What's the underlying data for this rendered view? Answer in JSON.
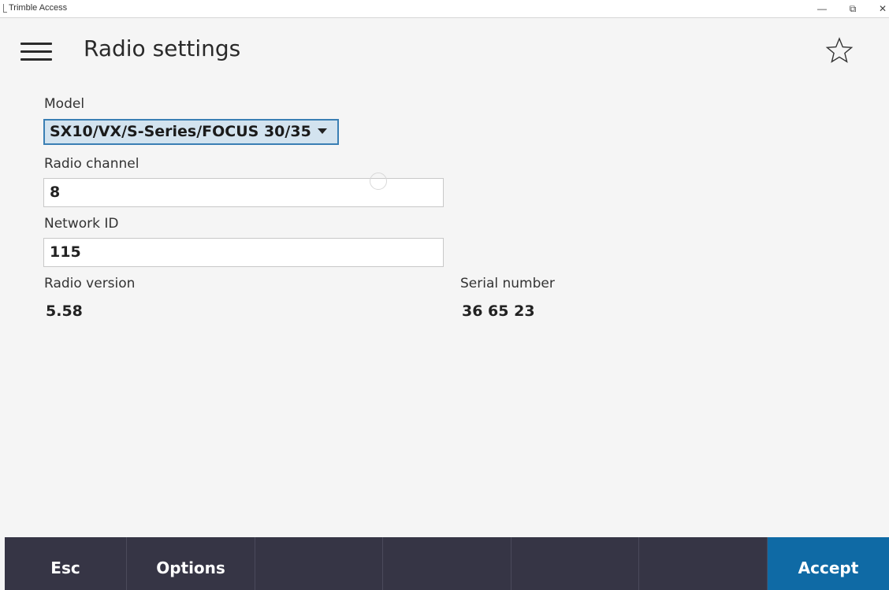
{
  "window": {
    "title": "Trimble Access",
    "min_glyph": "—",
    "max_glyph": "⧉",
    "close_glyph": "✕"
  },
  "header": {
    "title": "Radio settings",
    "menu_icon": "hamburger-menu-icon",
    "favorite_icon": "star-outline-icon"
  },
  "form": {
    "model_label": "Model",
    "model_value": "SX10/VX/S-Series/FOCUS 30/35",
    "channel_label": "Radio channel",
    "channel_value": "8",
    "network_label": "Network ID",
    "network_value": "115",
    "version_label": "Radio version",
    "version_value": "5.58",
    "serial_label": "Serial number",
    "serial_value": "36 65 23"
  },
  "softkeys": {
    "esc": "Esc",
    "options": "Options",
    "accept": "Accept"
  },
  "colors": {
    "accent": "#0f6aa5",
    "bottombar": "#363545",
    "dropdown_bg": "#d3e3ef",
    "dropdown_border": "#3a7fb4"
  }
}
